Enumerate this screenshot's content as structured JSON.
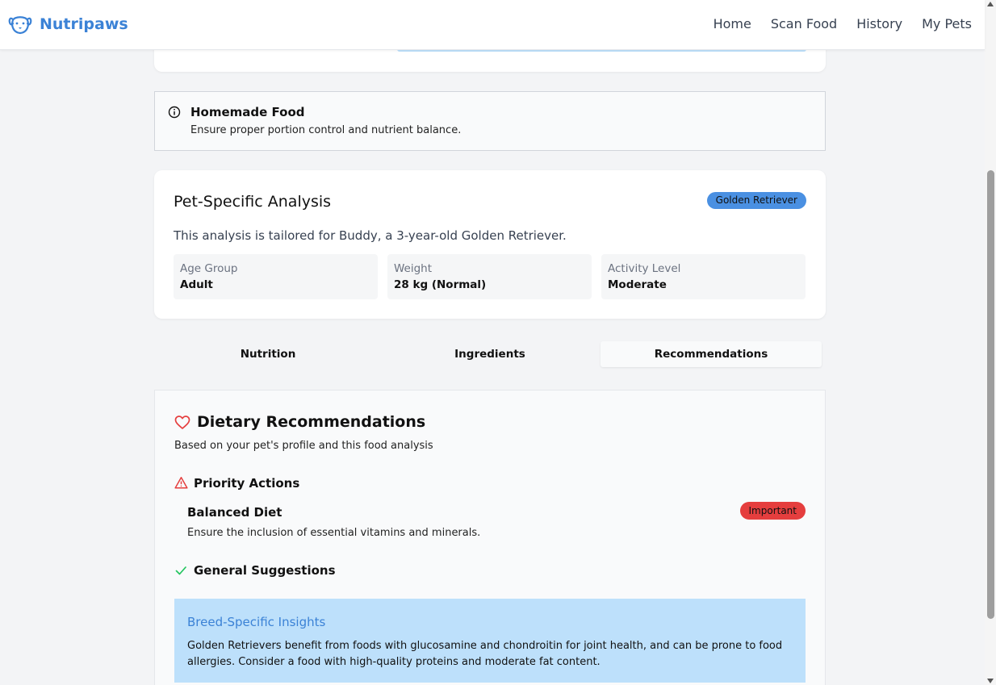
{
  "nav": {
    "brand": "Nutripaws",
    "links": [
      "Home",
      "Scan Food",
      "History",
      "My Pets"
    ]
  },
  "alert": {
    "title": "Homemade Food",
    "text": "Ensure proper portion control and nutrient balance."
  },
  "pet_analysis": {
    "title": "Pet-Specific Analysis",
    "badge": "Golden Retriever",
    "description": "This analysis is tailored for Buddy, a 3-year-old Golden Retriever.",
    "stats": [
      {
        "label": "Age Group",
        "value": "Adult"
      },
      {
        "label": "Weight",
        "value": "28 kg (Normal)"
      },
      {
        "label": "Activity Level",
        "value": "Moderate"
      }
    ]
  },
  "tabs": {
    "items": [
      "Nutrition",
      "Ingredients",
      "Recommendations"
    ],
    "active": "Recommendations"
  },
  "recommendations": {
    "title": "Dietary Recommendations",
    "subtitle": "Based on your pet's profile and this food analysis",
    "priority_title": "Priority Actions",
    "priority_items": [
      {
        "title": "Balanced Diet",
        "badge": "Important",
        "text": "Ensure the inclusion of essential vitamins and minerals."
      }
    ],
    "general_title": "General Suggestions",
    "insight": {
      "title": "Breed-Specific Insights",
      "text": "Golden Retrievers benefit from foods with glucosamine and chondroitin for joint health, and can be prone to food allergies. Consider a food with high-quality proteins and moderate fat content."
    }
  },
  "colors": {
    "brand": "#3b82d6",
    "breed_badge": "#4a90e2",
    "important_badge": "#e53e3e",
    "insight_bg": "#bde0fb",
    "check": "#22c55e",
    "alert_red": "#e53e3e"
  }
}
